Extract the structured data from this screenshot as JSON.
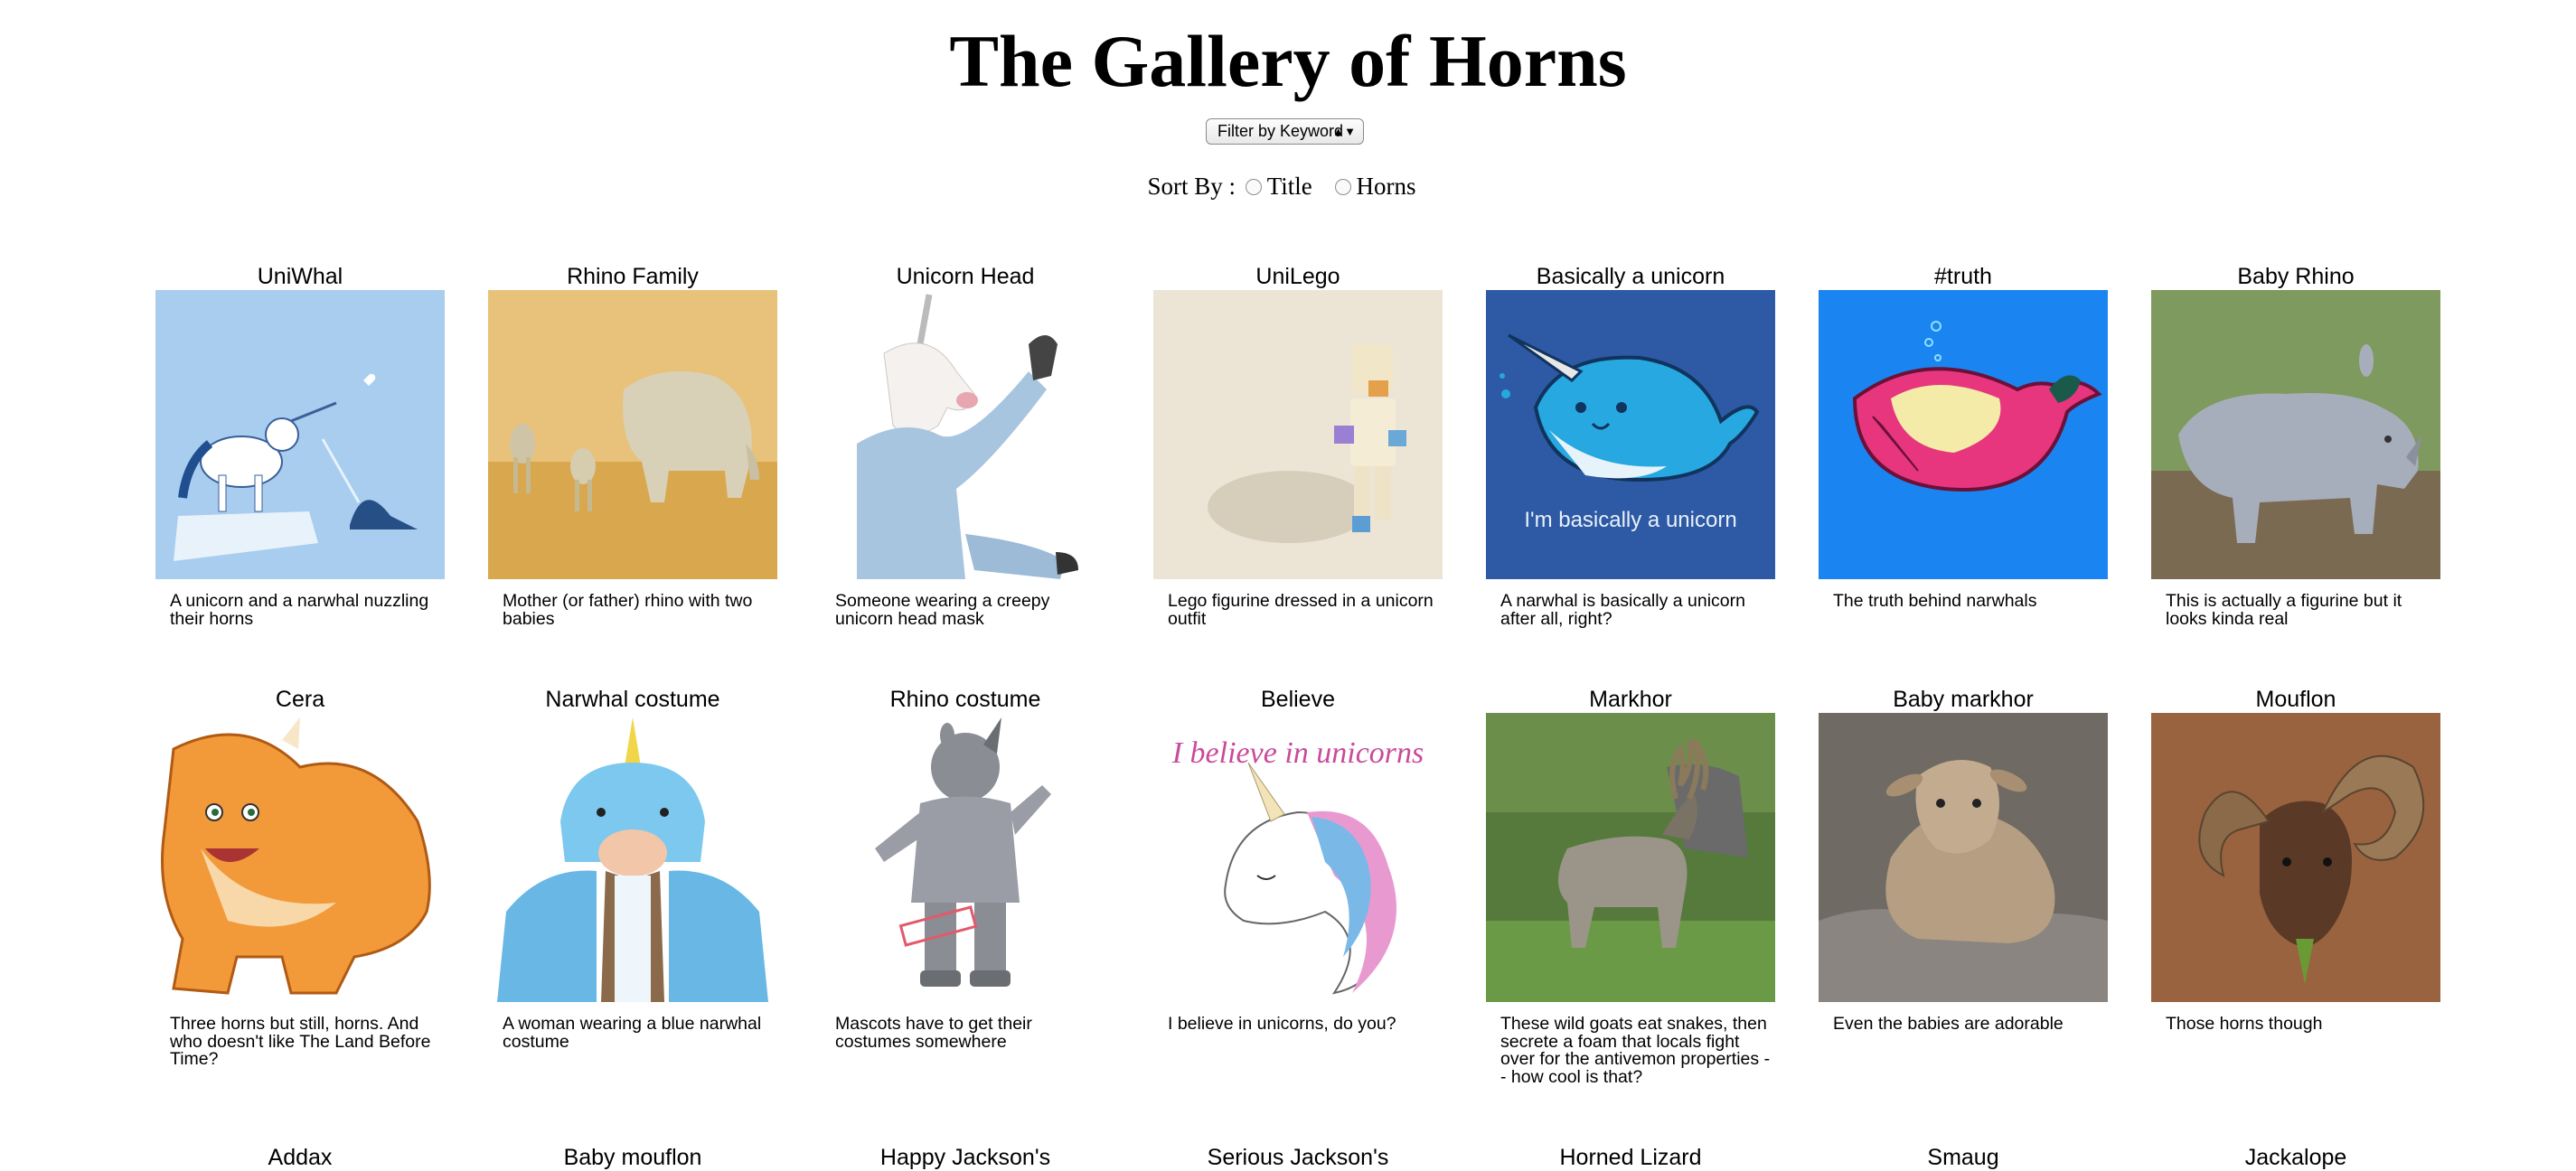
{
  "page": {
    "title": "The Gallery of Horns",
    "filter_label": "Filter by Keyword",
    "sort_prefix": "Sort By :",
    "sort_options": [
      "Title",
      "Horns"
    ]
  },
  "gallery": [
    {
      "title": "UniWhal",
      "description": "A unicorn and a narwhal nuzzling their horns"
    },
    {
      "title": "Rhino Family",
      "description": "Mother (or father) rhino with two babies"
    },
    {
      "title": "Unicorn Head",
      "description": "Someone wearing a creepy unicorn head mask"
    },
    {
      "title": "UniLego",
      "description": "Lego figurine dressed in a unicorn outfit"
    },
    {
      "title": "Basically a unicorn",
      "description": "A narwhal is basically a unicorn after all, right?",
      "image_text": "I'm basically a unicorn"
    },
    {
      "title": "#truth",
      "description": "The truth behind narwhals"
    },
    {
      "title": "Baby Rhino",
      "description": "This is actually a figurine but it looks kinda real"
    },
    {
      "title": "Cera",
      "description": "Three horns but still, horns. And who doesn't like The Land Before Time?"
    },
    {
      "title": "Narwhal costume",
      "description": "A woman wearing a blue narwhal costume"
    },
    {
      "title": "Rhino costume",
      "description": "Mascots have to get their costumes somewhere"
    },
    {
      "title": "Believe",
      "description": "I believe in unicorns, do you?",
      "image_text": "I believe in unicorns"
    },
    {
      "title": "Markhor",
      "description": "These wild goats eat snakes, then secrete a foam that locals fight over for the antivemon properties -- how cool is that?"
    },
    {
      "title": "Baby markhor",
      "description": "Even the babies are adorable"
    },
    {
      "title": "Mouflon",
      "description": "Those horns though"
    },
    {
      "title": "Addax"
    },
    {
      "title": "Baby mouflon"
    },
    {
      "title": "Happy Jackson's"
    },
    {
      "title": "Serious Jackson's"
    },
    {
      "title": "Horned Lizard"
    },
    {
      "title": "Smaug"
    },
    {
      "title": "Jackalope"
    }
  ],
  "colors": {
    "card_bg_1": "#a8cdee",
    "card_bg_5": "#2e59a4",
    "card_bg_6": "#1a85f0"
  }
}
